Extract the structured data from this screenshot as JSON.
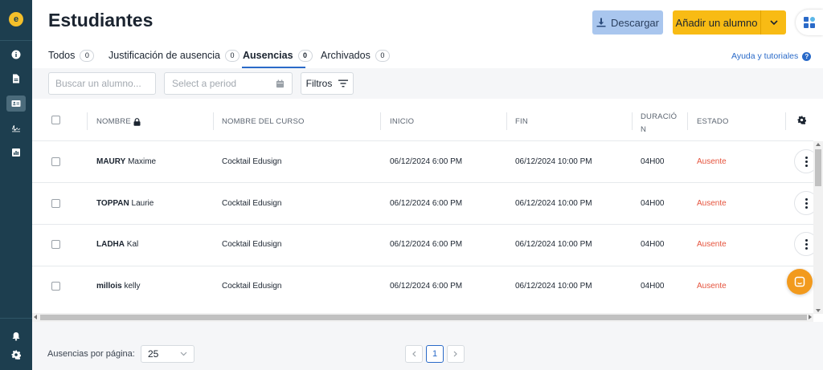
{
  "header": {
    "title": "Estudiantes",
    "download_label": "Descargar",
    "add_label": "Añadir un alumno"
  },
  "tabs": [
    {
      "label": "Todos",
      "count": "0"
    },
    {
      "label": "Justificación de ausencia",
      "count": "0"
    },
    {
      "label": "Ausencias",
      "count": "0",
      "active": true
    },
    {
      "label": "Archivados",
      "count": "0"
    }
  ],
  "help_link": "Ayuda y tutoriales",
  "filters": {
    "search_placeholder": "Buscar un alumno...",
    "period_placeholder": "Select a period",
    "filters_label": "Filtros"
  },
  "table": {
    "headers": {
      "name": "NOMBRE",
      "course": "NOMBRE DEL CURSO",
      "start": "INICIO",
      "end": "FIN",
      "duration_1": "DURACIÓ",
      "duration_2": "N",
      "status": "ESTADO"
    },
    "rows": [
      {
        "last": "MAURY",
        "first": "Maxime",
        "course": "Cocktail Edusign",
        "start": "06/12/2024 6:00 PM",
        "end": "06/12/2024 10:00 PM",
        "duration": "04H00",
        "status": "Ausente"
      },
      {
        "last": "TOPPAN",
        "first": "Laurie",
        "course": "Cocktail Edusign",
        "start": "06/12/2024 6:00 PM",
        "end": "06/12/2024 10:00 PM",
        "duration": "04H00",
        "status": "Ausente"
      },
      {
        "last": "LADHA",
        "first": "Kal",
        "course": "Cocktail Edusign",
        "start": "06/12/2024 6:00 PM",
        "end": "06/12/2024 10:00 PM",
        "duration": "04H00",
        "status": "Ausente"
      },
      {
        "last": "millois",
        "first": "kelly",
        "course": "Cocktail Edusign",
        "start": "06/12/2024 6:00 PM",
        "end": "06/12/2024 10:00 PM",
        "duration": "04H00",
        "status": "Ausente"
      }
    ]
  },
  "footer": {
    "per_page_label": "Ausencias por página:",
    "per_page_value": "25",
    "current_page": "1"
  },
  "colors": {
    "sidebar": "#1d3e4f",
    "accent_yellow": "#f8bb14",
    "download_blue": "#a9c6ee",
    "link_blue": "#2a6ac8",
    "status_red": "#e5533d",
    "chat_orange": "#f29a1d"
  },
  "icons": {
    "sidebar": [
      "info-icon",
      "document-icon",
      "id-card-icon",
      "signature-icon",
      "chart-icon",
      "bell-icon",
      "settings-icon"
    ],
    "header": [
      "download-icon",
      "chevron-down-icon",
      "app-grid-icon"
    ],
    "filters": [
      "calendar-icon",
      "filter-icon"
    ],
    "table": [
      "lock-icon",
      "gear-icon",
      "more-options-icon"
    ],
    "misc": [
      "chat-icon",
      "help-icon"
    ]
  }
}
